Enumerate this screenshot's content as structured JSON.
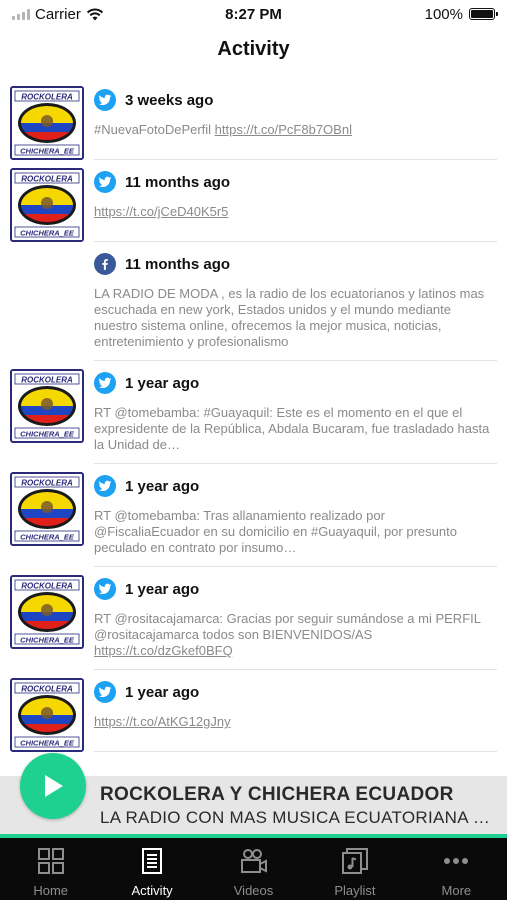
{
  "status_bar": {
    "carrier": "Carrier",
    "time": "8:27 PM",
    "battery": "100%",
    "battery_level": 1.0
  },
  "nav": {
    "title": "Activity"
  },
  "thumb": {
    "line1": "ROCKOLERA",
    "line2": "CHICHERA_EE"
  },
  "colors": {
    "accent": "#1fd191",
    "twitter": "#1da1f2",
    "facebook": "#3b5998",
    "tabbar": "#0a0a0a"
  },
  "feed": [
    {
      "network": "twitter",
      "has_thumb": true,
      "when": "3 weeks ago",
      "text": "#NuevaFotoDePerfil ",
      "link": "https://t.co/PcF8b7OBnl"
    },
    {
      "network": "twitter",
      "has_thumb": true,
      "when": "11 months ago",
      "text": "",
      "link": "https://t.co/jCeD40K5r5"
    },
    {
      "network": "facebook",
      "has_thumb": false,
      "when": "11 months ago",
      "text": "LA RADIO DE MODA , es la radio de los ecuatorianos y latinos mas escuchada en new york, Estados unidos y el mundo mediante nuestro sistema online, ofrecemos la mejor musica, noticias, entretenimiento y profesionalismo",
      "link": ""
    },
    {
      "network": "twitter",
      "has_thumb": true,
      "when": "1 year ago",
      "text": "RT @tomebamba: #Guayaquil: Este es el momento en el que el expresidente de la República, Abdala Bucaram, fue trasladado hasta la Unidad de…",
      "link": ""
    },
    {
      "network": "twitter",
      "has_thumb": true,
      "when": "1 year ago",
      "text": "RT @tomebamba: Tras allanamiento realizado por @FiscaliaEcuador en su domicilio en #Guayaquil, por presunto peculado en contrato por insumo…",
      "link": ""
    },
    {
      "network": "twitter",
      "has_thumb": true,
      "when": "1 year ago",
      "text": "RT @rositacajamarca: Gracias por seguir sumándose a mi PERFIL @rositacajamarca todos son BIENVENIDOS/AS ",
      "link": "https://t.co/dzGkef0BFQ"
    },
    {
      "network": "twitter",
      "has_thumb": true,
      "when": "1 year ago",
      "text": "",
      "link": "https://t.co/AtKG12gJny"
    }
  ],
  "player": {
    "title": "ROCKOLERA Y CHICHERA ECUADOR",
    "subtitle": "LA RADIO CON MAS MUSICA ECUATORIANA DEL MUNDO",
    "icon": "play-icon"
  },
  "tabs": [
    {
      "label": "Home",
      "icon": "home-grid-icon",
      "active": false
    },
    {
      "label": "Activity",
      "icon": "activity-list-icon",
      "active": true
    },
    {
      "label": "Videos",
      "icon": "video-camera-icon",
      "active": false
    },
    {
      "label": "Playlist",
      "icon": "playlist-music-icon",
      "active": false
    },
    {
      "label": "More",
      "icon": "more-dots-icon",
      "active": false
    }
  ]
}
